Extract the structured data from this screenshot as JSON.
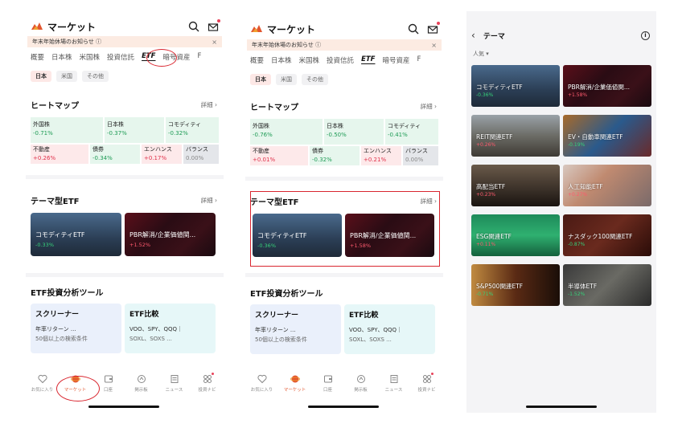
{
  "screen1": {
    "title": "マーケット",
    "notice": "年末年始休場のお知らせ ⓘ",
    "notice_close": "×",
    "tabs": [
      "概要",
      "日本株",
      "米国株",
      "投資信託",
      "ETF",
      "暗号資産",
      "F"
    ],
    "active_tab": "ETF",
    "chips": [
      "日本",
      "米国",
      "その他"
    ],
    "heatmap": {
      "title": "ヒートマップ",
      "more": "詳細 ›",
      "cells": [
        {
          "name": "外国株",
          "value": "-0.71%"
        },
        {
          "name": "日本株",
          "value": "-0.37%"
        },
        {
          "name": "コモディティ",
          "value": "-0.32%"
        },
        {
          "name": "不動産",
          "value": "+0.26%"
        },
        {
          "name": "債券",
          "value": "-0.34%"
        },
        {
          "name": "エンハンス",
          "value": "+0.17%"
        },
        {
          "name": "バランス",
          "value": "0.00%"
        }
      ]
    },
    "theme": {
      "title": "テーマ型ETF",
      "more": "詳細 ›",
      "cards": [
        {
          "name": "コモディティETF",
          "change": "-0.33%"
        },
        {
          "name": "PBR解消/企業価値関...",
          "change": "+1.52%"
        }
      ]
    },
    "tools": {
      "title": "ETF投資分析ツール",
      "items": [
        {
          "name": "スクリーナー",
          "line1": "年率リターン ...",
          "line2": "50個以上の検索条件"
        },
        {
          "name": "ETF比較",
          "line1": "VOO、SPY、QQQ｜",
          "line2": "SOXL、SOXS ..."
        }
      ]
    },
    "nav": [
      "お気に入り",
      "マーケット",
      "口座",
      "掲示板",
      "ニュース",
      "投資ナビ"
    ],
    "nav_active": 1
  },
  "screen2": {
    "title": "マーケット",
    "notice": "年末年始休場のお知らせ ⓘ",
    "notice_close": "×",
    "tabs": [
      "概要",
      "日本株",
      "米国株",
      "投資信託",
      "ETF",
      "暗号資産",
      "F"
    ],
    "chips": [
      "日本",
      "米国",
      "その他"
    ],
    "heatmap": {
      "title": "ヒートマップ",
      "more": "詳細 ›",
      "cells": [
        {
          "name": "外国株",
          "value": "-0.76%"
        },
        {
          "name": "日本株",
          "value": "-0.50%"
        },
        {
          "name": "コモディティ",
          "value": "-0.41%"
        },
        {
          "name": "不動産",
          "value": "+0.01%"
        },
        {
          "name": "債券",
          "value": "-0.32%"
        },
        {
          "name": "エンハンス",
          "value": "+0.21%"
        },
        {
          "name": "バランス",
          "value": "0.00%"
        }
      ]
    },
    "theme": {
      "title": "テーマ型ETF",
      "more": "詳細 ›",
      "cards": [
        {
          "name": "コモディティETF",
          "change": "-0.36%"
        },
        {
          "name": "PBR解消/企業価値関...",
          "change": "+1.58%"
        }
      ]
    },
    "tools": {
      "title": "ETF投資分析ツール",
      "items": [
        {
          "name": "スクリーナー",
          "line1": "年率リターン ...",
          "line2": "50個以上の検索条件"
        },
        {
          "name": "ETF比較",
          "line1": "VOO、SPY、QQQ｜",
          "line2": "SOXL、SOXS ..."
        }
      ]
    },
    "nav": [
      "お気に入り",
      "マーケット",
      "口座",
      "掲示板",
      "ニュース",
      "投資ナビ"
    ],
    "nav_active": 1
  },
  "screen3": {
    "back": "‹",
    "title": "テーマ",
    "info": "i",
    "sort": "人気 ▾",
    "themes": [
      {
        "name": "コモディティETF",
        "change": "-0.36%"
      },
      {
        "name": "PBR解消/企業価値関...",
        "change": "+1.58%"
      },
      {
        "name": "REIT関連ETF",
        "change": "+0.26%"
      },
      {
        "name": "EV・自動車関連ETF",
        "change": "-0.19%"
      },
      {
        "name": "高配当ETF",
        "change": "+0.23%"
      },
      {
        "name": "人工知能ETF",
        "change": "+0.27%"
      },
      {
        "name": "ESG関連ETF",
        "change": "+0.11%"
      },
      {
        "name": "ナスダック100関連ETF",
        "change": "-0.87%"
      },
      {
        "name": "S&P500関連ETF",
        "change": "-0.71%"
      },
      {
        "name": "半導体ETF",
        "change": "-1.52%"
      }
    ]
  },
  "colors": {
    "accent": "#e2562f",
    "up": "#e0314a",
    "down": "#1e9b55",
    "highlight": "#d9262f"
  }
}
